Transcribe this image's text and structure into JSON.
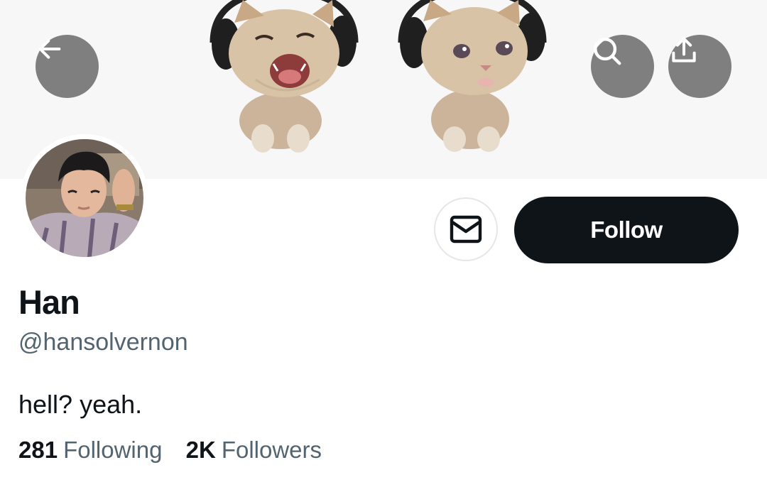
{
  "header": {
    "back_icon": "arrow-left-icon",
    "search_icon": "search-icon",
    "share_icon": "share-upload-icon"
  },
  "banner": {
    "description_icon": "kittens-with-headphones"
  },
  "profile": {
    "display_name": "Han",
    "handle": "@hansolvernon",
    "bio": "hell? yeah.",
    "following_count": "281",
    "following_label": "Following",
    "followers_count": "2K",
    "followers_label": "Followers"
  },
  "actions": {
    "message_icon": "mail-icon",
    "follow_label": "Follow"
  },
  "colors": {
    "text_primary": "#0f1419",
    "text_secondary": "#536471",
    "follow_button_bg": "#0f1419",
    "banner_bg": "#f7f7f8"
  }
}
